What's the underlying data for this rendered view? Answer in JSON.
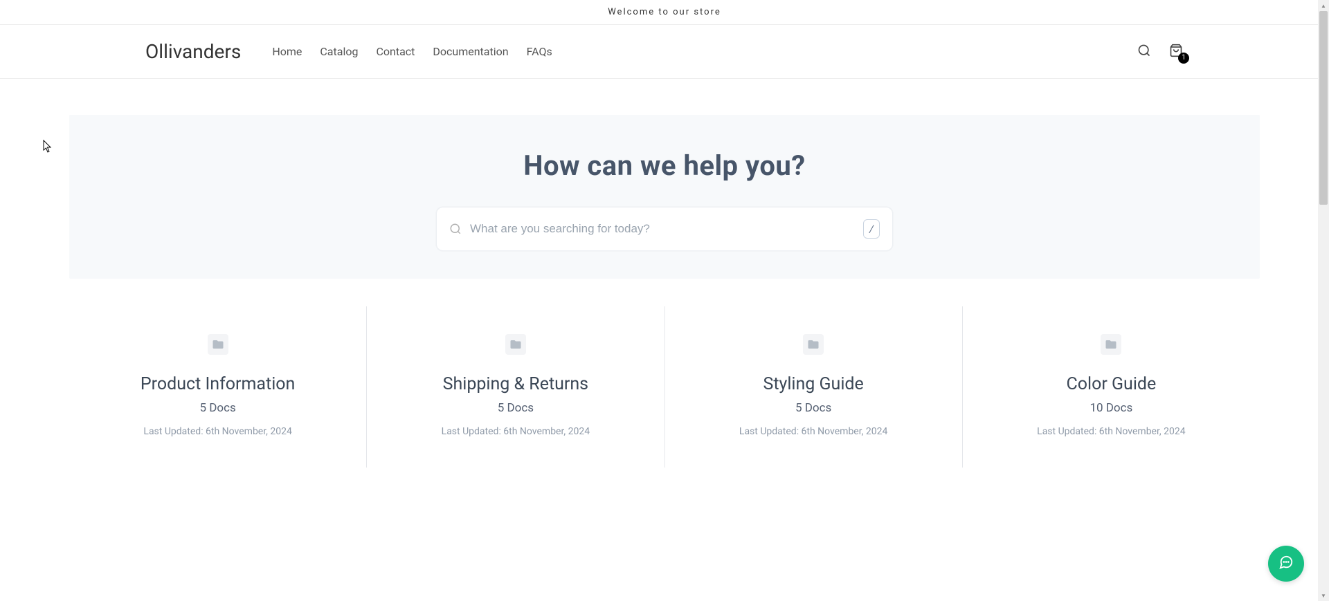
{
  "announcement": "Welcome to our store",
  "brand": "Ollivanders",
  "nav": [
    {
      "label": "Home"
    },
    {
      "label": "Catalog"
    },
    {
      "label": "Contact"
    },
    {
      "label": "Documentation"
    },
    {
      "label": "FAQs"
    }
  ],
  "cart": {
    "count": "1"
  },
  "hero": {
    "title": "How can we help you?",
    "search_placeholder": "What are you searching for today?",
    "kbd_hint": "/"
  },
  "categories": [
    {
      "title": "Product Information",
      "count": "5 Docs",
      "updated": "Last Updated: 6th November, 2024"
    },
    {
      "title": "Shipping & Returns",
      "count": "5 Docs",
      "updated": "Last Updated: 6th November, 2024"
    },
    {
      "title": "Styling Guide",
      "count": "5 Docs",
      "updated": "Last Updated: 6th November, 2024"
    },
    {
      "title": "Color Guide",
      "count": "10 Docs",
      "updated": "Last Updated: 6th November, 2024"
    }
  ]
}
